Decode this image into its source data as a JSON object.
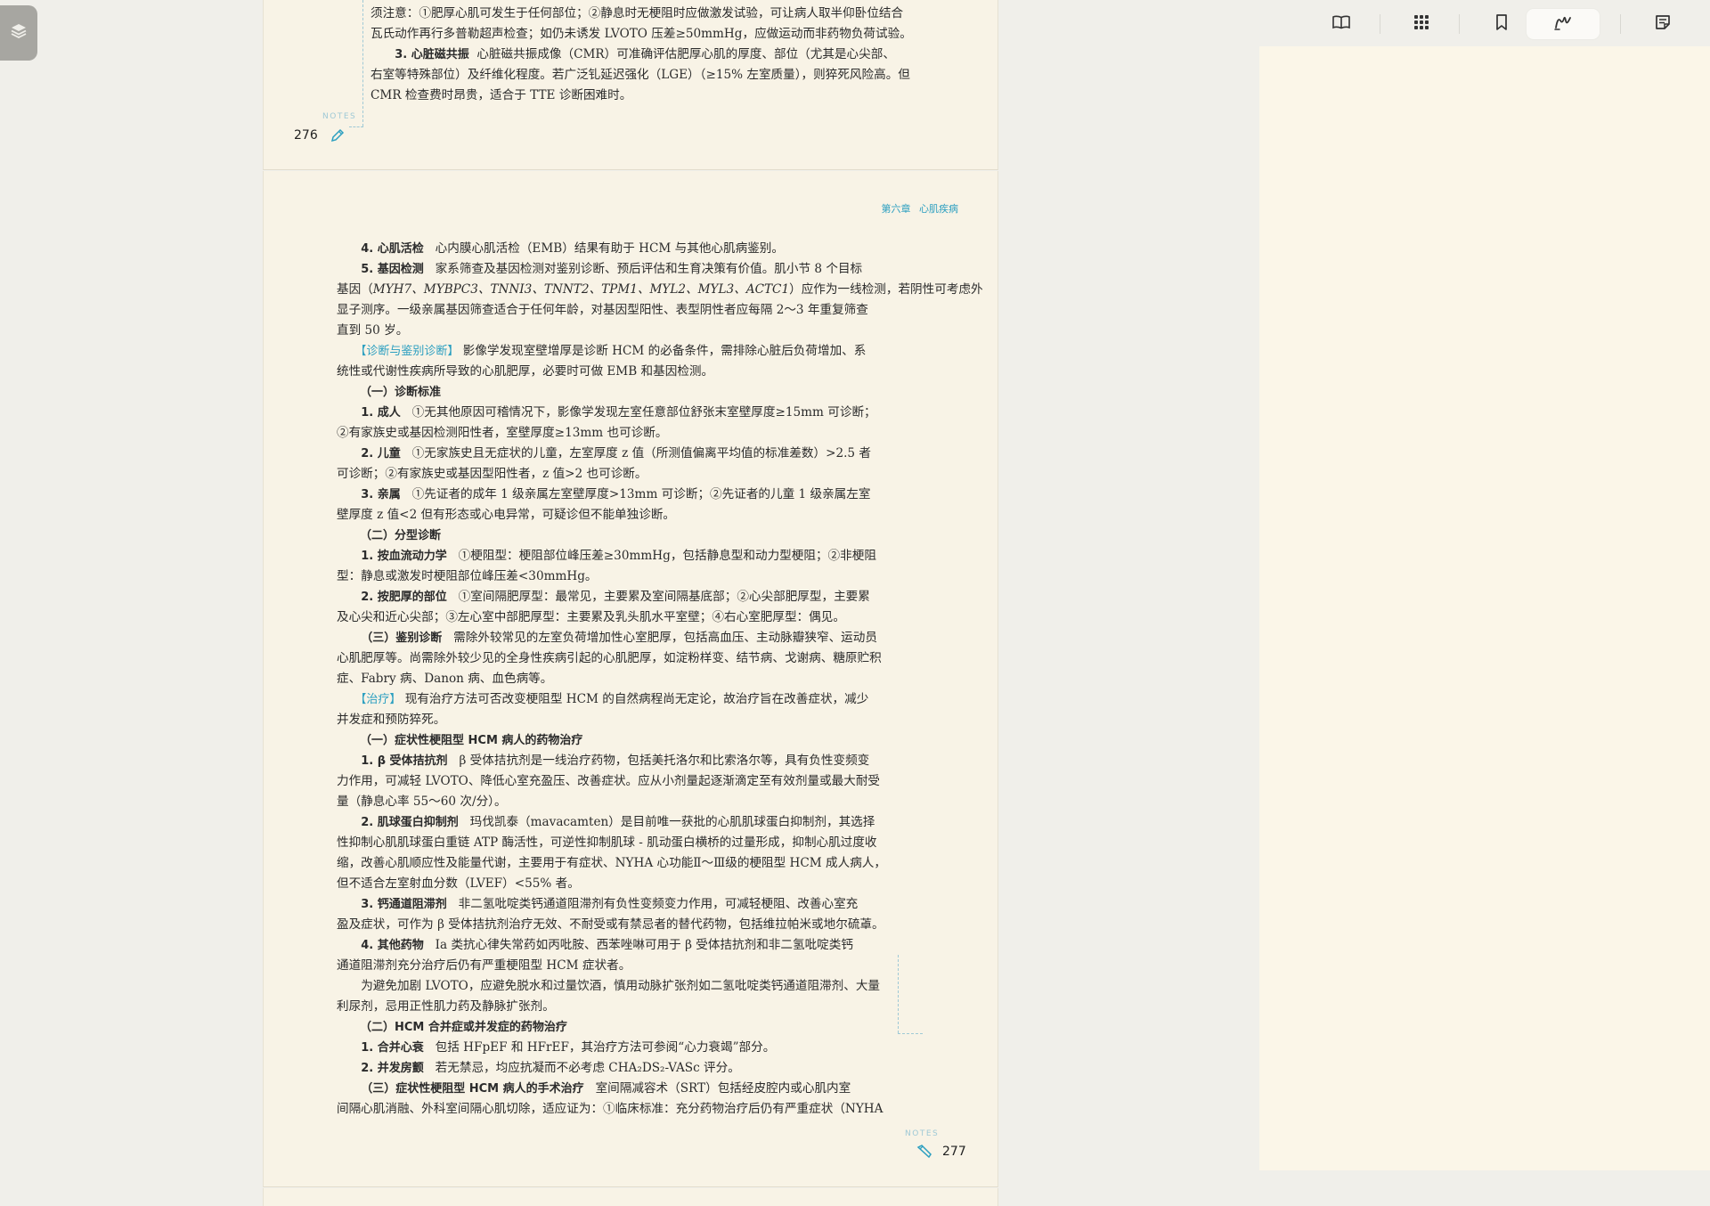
{
  "toolbar": {
    "items": [
      "book-view",
      "grid-view",
      "bookmark",
      "handwriting",
      "notes"
    ]
  },
  "page_top": {
    "lines": [
      "须注意：①肥厚心肌可发生于任何部位；②静息时无梗阻时应做激发试验，可让病人取半仰卧位结合",
      "瓦氏动作再行多普勒超声检查；如仍未诱发 LVOTO 压差≥50mmHg，应做运动而非药物负荷试验。"
    ],
    "item3_label": "3. 心脏磁共振",
    "item3_lines": [
      "心脏磁共振成像（CMR）可准确评估肥厚心肌的厚度、部位（尤其是心尖部、",
      "右室等特殊部位）及纤维化程度。若广泛钆延迟强化（LGE）（≥15% 左室质量），则猝死风险高。但",
      "CMR 检查费时昂贵，适合于 TTE 诊断困难时。"
    ],
    "notes_label": "NOTES",
    "page_number": "276"
  },
  "page_main": {
    "running_head": "第六章  心肌疾病",
    "notes_label": "NOTES",
    "page_number": "277",
    "l01a": "4. 心肌活检",
    "l01b": "心内膜心肌活检（EMB）结果有助于 HCM 与其他心肌病鉴别。",
    "l02a": "5. 基因检测",
    "l02b": "家系筛查及基因检测对鉴别诊断、预后评估和生育决策有价值。肌小节 8 个目标",
    "l03a": "基因（",
    "l03g": "MYH7、MYBPC3、TNNI3、TNNT2、TPM1、MYL2、MYL3、ACTC1",
    "l03b": "）应作为一线检测，若阴性可考虑外",
    "l04": "显子测序。一级亲属基因筛查适合于任何年龄，对基因型阳性、表型阴性者应每隔 2～3 年重复筛查",
    "l05": "直到 50 岁。",
    "l06a": "【诊断与鉴别诊断】",
    "l06b": "影像学发现室壁增厚是诊断 HCM 的必备条件，需排除心脏后负荷增加、系",
    "l07": "统性或代谢性疾病所导致的心肌肥厚，必要时可做 EMB 和基因检测。",
    "l08": "（一）诊断标准",
    "l09a": "1. 成人",
    "l09b": "①无其他原因可稽情况下，影像学发现左室任意部位舒张末室壁厚度≥15mm 可诊断；",
    "l10": "②有家族史或基因检测阳性者，室壁厚度≥13mm 也可诊断。",
    "l11a": "2. 儿童",
    "l11b": "①无家族史且无症状的儿童，左室厚度 z 值（所测值偏离平均值的标准差数）>2.5 者",
    "l12": "可诊断；②有家族史或基因型阳性者，z 值>2 也可诊断。",
    "l13a": "3. 亲属",
    "l13b": "①先证者的成年 1 级亲属左室壁厚度>13mm 可诊断；②先证者的儿童 1 级亲属左室",
    "l14": "壁厚度 z 值<2 但有形态或心电异常，可疑诊但不能单独诊断。",
    "l15": "（二）分型诊断",
    "l16a": "1. 按血流动力学",
    "l16b": "①梗阻型：梗阻部位峰压差≥30mmHg，包括静息型和动力型梗阻；②非梗阻",
    "l17": "型：静息或激发时梗阻部位峰压差<30mmHg。",
    "l18a": "2. 按肥厚的部位",
    "l18b": "①室间隔肥厚型：最常见，主要累及室间隔基底部；②心尖部肥厚型，主要累",
    "l19": "及心尖和近心尖部；③左心室中部肥厚型：主要累及乳头肌水平室壁；④右心室肥厚型：偶见。",
    "l20a": "（三）鉴别诊断",
    "l20b": "需除外较常见的左室负荷增加性心室肥厚，包括高血压、主动脉瓣狭窄、运动员",
    "l21": "心肌肥厚等。尚需除外较少见的全身性疾病引起的心肌肥厚，如淀粉样变、结节病、戈谢病、糖原贮积",
    "l22": "症、Fabry 病、Danon 病、血色病等。",
    "l23a": "【治疗】",
    "l23b": "现有治疗方法可否改变梗阻型 HCM 的自然病程尚无定论，故治疗旨在改善症状，减少",
    "l24": "并发症和预防猝死。",
    "l25": "（一）症状性梗阻型 HCM 病人的药物治疗",
    "l26a": "1. β 受体拮抗剂",
    "l26b": "β 受体拮抗剂是一线治疗药物，包括美托洛尔和比索洛尔等，具有负性变频变",
    "l27": "力作用，可减轻 LVOTO、降低心室充盈压、改善症状。应从小剂量起逐渐滴定至有效剂量或最大耐受",
    "l28": "量（静息心率 55～60 次/分）。",
    "l29a": "2. 肌球蛋白抑制剂",
    "l29b": "玛伐凯泰（mavacamten）是目前唯一获批的心肌肌球蛋白抑制剂，其选择",
    "l30": "性抑制心肌肌球蛋白重链 ATP 酶活性，可逆性抑制肌球 - 肌动蛋白横桥的过量形成，抑制心肌过度收",
    "l31": "缩，改善心肌顺应性及能量代谢，主要用于有症状、NYHA 心功能Ⅱ～Ⅲ级的梗阻型 HCM 成人病人，",
    "l32": "但不适合左室射血分数（LVEF）<55% 者。",
    "l33a": "3. 钙通道阻滞剂",
    "l33b": "非二氢吡啶类钙通道阻滞剂有负性变频变力作用，可减轻梗阻、改善心室充",
    "l34": "盈及症状，可作为 β 受体拮抗剂治疗无效、不耐受或有禁忌者的替代药物，包括维拉帕米或地尔硫䓬。",
    "l35a": "4. 其他药物",
    "l35b": "Ⅰa 类抗心律失常药如丙吡胺、西苯唑啉可用于 β 受体拮抗剂和非二氢吡啶类钙",
    "l36": "通道阻滞剂充分治疗后仍有严重梗阻型 HCM 症状者。",
    "l37": "为避免加剧 LVOTO，应避免脱水和过量饮酒，慎用动脉扩张剂如二氢吡啶类钙通道阻滞剂、大量",
    "l38": "利尿剂，忌用正性肌力药及静脉扩张剂。",
    "l39": "（二）HCM 合并症或并发症的药物治疗",
    "l40a": "1. 合并心衰",
    "l40b": "包括 HFpEF 和 HFrEF，其治疗方法可参阅“心力衰竭”部分。",
    "l41a": "2. 并发房颤",
    "l41b": "若无禁忌，均应抗凝而不必考虑 CHA₂DS₂-VASc 评分。",
    "l42a": "（三）症状性梗阻型 HCM 病人的手术治疗",
    "l42b": "室间隔减容术（SRT）包括经皮腔内或心肌内室",
    "l43": "间隔心肌消融、外科室间隔心肌切除，适应证为：①临床标准：充分药物治疗后仍有严重症状（NYHA"
  }
}
